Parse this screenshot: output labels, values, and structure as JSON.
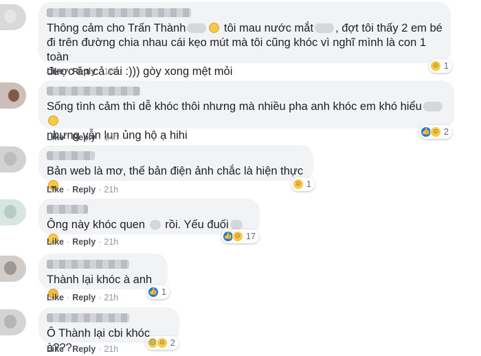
{
  "actions": {
    "like": "Like",
    "reply": "Reply",
    "separator": "·"
  },
  "colors": {
    "bubble": "#f2f3f5",
    "link": "#4b4f56",
    "like_blue": "#1877f2",
    "emoji_yellow": "#f7c948"
  },
  "comments": [
    {
      "author_redacted": true,
      "text_parts": [
        "Thông cảm cho Trấn Thành",
        " tôi mau nước mắt",
        ", đợt tôi thấy 2 em bé\nđi trên đường chia nhau cái kẹo mút mà tôi cũng khóc vì nghĩ mình là con 1 toàn\nđược ăn cả cái :))) gòy xong mệt mỏi"
      ],
      "time": "11h",
      "reactions": [
        "haha-icon"
      ],
      "reaction_count": "1"
    },
    {
      "author_redacted": true,
      "text_parts": [
        "Sống tình cảm thì dễ khóc thôi nhưng mà nhiều pha anh khóc em khó hiểu",
        "\nnhưng vẫn lun ủng hộ ạ hihi"
      ],
      "time": "14h",
      "reactions": [
        "like-icon",
        "haha-icon"
      ],
      "reaction_count": "2"
    },
    {
      "author_redacted": true,
      "text_parts": [
        "Bản web là mơ, thế bản điện ảnh chắc là hiện thực"
      ],
      "time": "21h",
      "reactions": [
        "haha-icon"
      ],
      "reaction_count": "1"
    },
    {
      "author_redacted": true,
      "text_parts": [
        "Ông này khóc quen ",
        " rồi. Yếu đuối"
      ],
      "time": "21h",
      "reactions": [
        "like-icon",
        "haha-icon"
      ],
      "reaction_count": "17"
    },
    {
      "author_redacted": true,
      "text_parts": [
        "Thành lại khóc à anh"
      ],
      "time": "21h",
      "reactions": [
        "like-icon"
      ],
      "reaction_count": "1"
    },
    {
      "author_redacted": true,
      "text_parts": [
        "Ô Thành lại cbi khóc à???"
      ],
      "time": "21h",
      "reactions": [
        "sad-icon",
        "haha-icon"
      ],
      "reaction_count": "2"
    }
  ]
}
